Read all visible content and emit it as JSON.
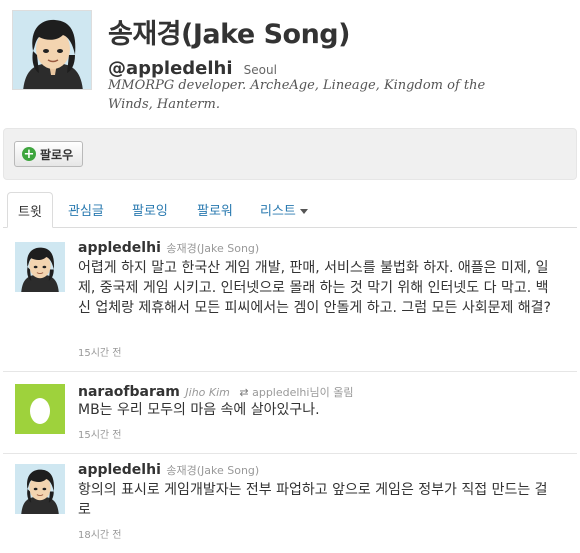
{
  "profile": {
    "name": "송재경(Jake Song)",
    "handle": "@appledelhi",
    "location": "Seoul",
    "bio": "MMORPG developer. ArcheAge, Lineage, Kingdom of the Winds, Hanterm."
  },
  "actions": {
    "follow_label": "팔로우"
  },
  "tabs": [
    {
      "label": "트윗"
    },
    {
      "label": "관심글"
    },
    {
      "label": "팔로잉"
    },
    {
      "label": "팔로워"
    },
    {
      "label": "리스트"
    }
  ],
  "tweets": [
    {
      "username": "appledelhi",
      "fullname": "송재경(Jake Song)",
      "text": "어렵게 하지 말고 한국산 게임 개발, 판매, 서비스를 불법화 하자. 애플은 미제, 일제, 중국제 게임 시키고. 인터넷으로 몰래 하는 것 막기 위해 인터넷도 다 막고. 백신 업체랑 제휴해서 모든 피씨에서는 겜이 안돌게 하고. 그럼 모든 사회문제 해결?",
      "time": "15시간 전"
    },
    {
      "username": "naraofbaram",
      "fullname": "Jiho Kim",
      "retweet_note": "appledelhi님이 올림",
      "text": "MB는 우리 모두의 마음 속에 살아있구나.",
      "time": "15시간 전"
    },
    {
      "username": "appledelhi",
      "fullname": "송재경(Jake Song)",
      "text": "항의의 표시로 게임개발자는 전부 파업하고 앞으로 게임은 정부가 직접 만드는 걸로",
      "time": "18시간 전"
    }
  ]
}
